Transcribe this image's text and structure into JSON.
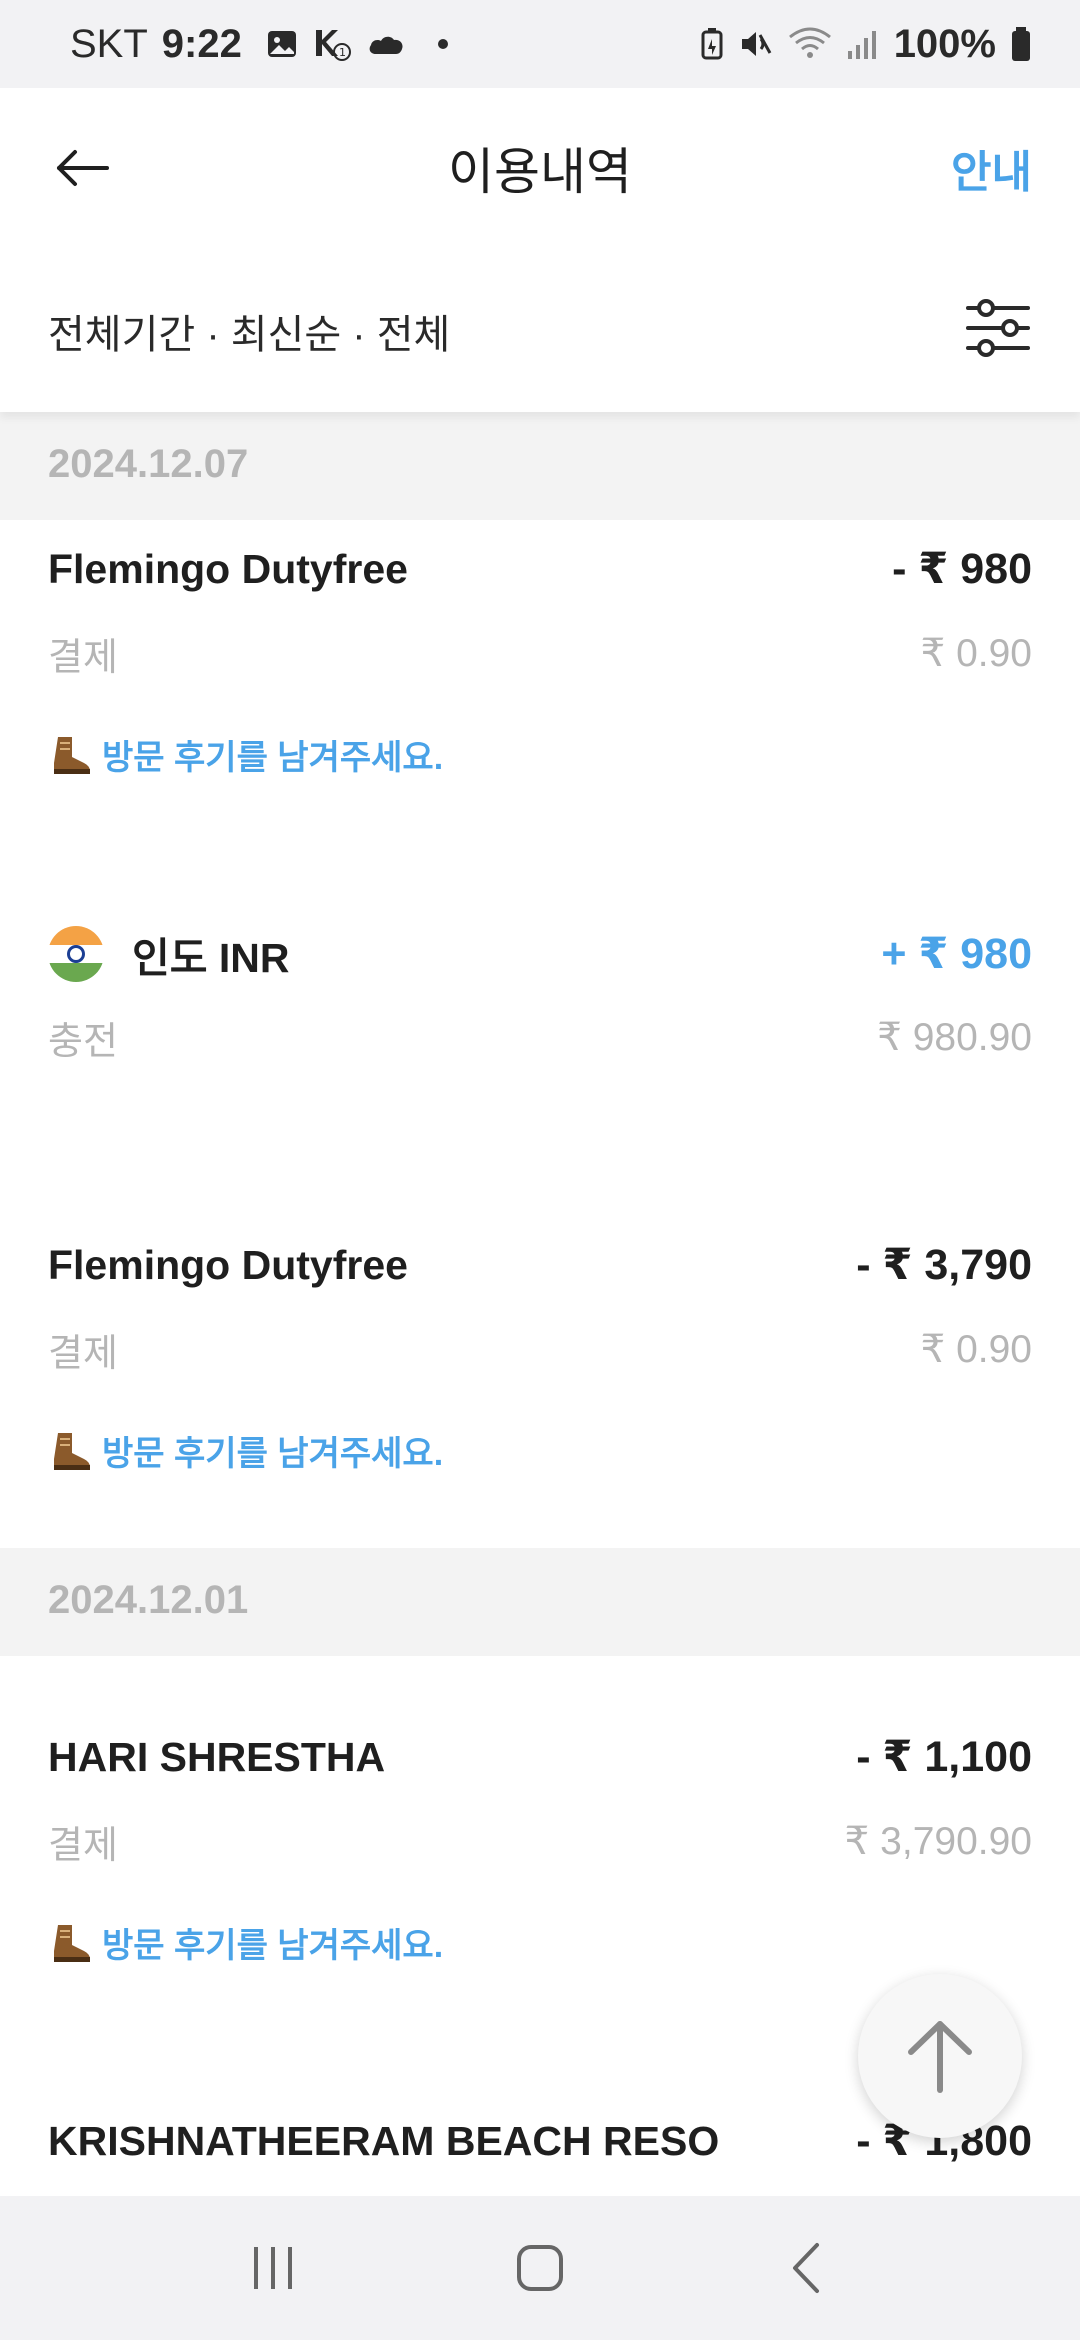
{
  "status_bar": {
    "carrier": "SKT",
    "time": "9:22",
    "battery_percent": "100%"
  },
  "app_bar": {
    "title": "이용내역",
    "info_label": "안내"
  },
  "filter": {
    "summary": "전체기간 · 최신순 · 전체"
  },
  "sections": [
    {
      "date": "2024.12.07",
      "transactions": [
        {
          "merchant": "Flemingo Dutyfree",
          "amount": "- ₹ 980",
          "type": "결제",
          "balance": "₹ 0.90",
          "review": "방문 후기를 남겨주세요."
        },
        {
          "merchant": "인도 INR",
          "amount": "+ ₹ 980",
          "type": "충전",
          "balance": "₹ 980.90"
        },
        {
          "merchant": "Flemingo Dutyfree",
          "amount": "- ₹ 3,790",
          "type": "결제",
          "balance": "₹ 0.90",
          "review": "방문 후기를 남겨주세요."
        }
      ]
    },
    {
      "date": "2024.12.01",
      "transactions": [
        {
          "merchant": "HARI SHRESTHA",
          "amount": "- ₹ 1,100",
          "type": "결제",
          "balance": "₹ 3,790.90",
          "review": "방문 후기를 남겨주세요."
        },
        {
          "merchant": "KRISHNATHEERAM BEACH RESO",
          "amount": "- ₹ 1,800"
        }
      ]
    }
  ],
  "icons": {
    "back": "arrow-left-icon",
    "filter": "sliders-icon",
    "review": "boot-icon",
    "scroll_top": "arrow-up-icon"
  },
  "colors": {
    "accent": "#4aa3e8",
    "muted": "#b5b5b5",
    "section_bg": "#f3f3f3"
  }
}
